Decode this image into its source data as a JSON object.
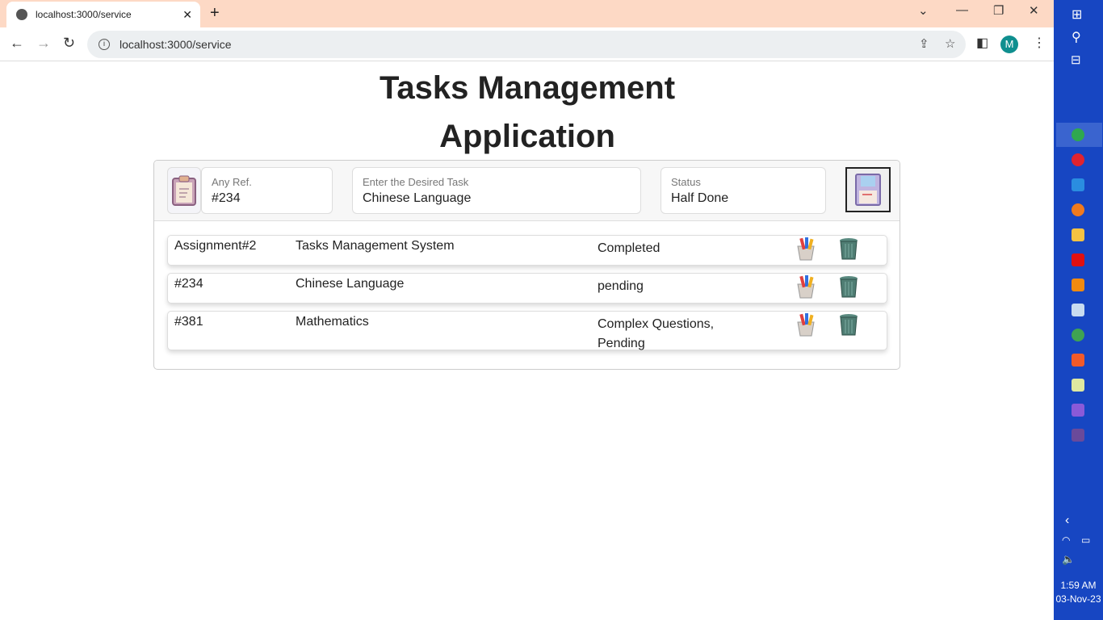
{
  "browser": {
    "tab_title": "localhost:3000/service",
    "url": "localhost:3000/service",
    "profile_initial": "M"
  },
  "page": {
    "title": "Tasks Management Application"
  },
  "form": {
    "ref": {
      "label": "Any Ref.",
      "value": "#234"
    },
    "task": {
      "label": "Enter the Desired Task",
      "value": "Chinese Language"
    },
    "status": {
      "label": "Status",
      "value": "Half Done"
    }
  },
  "tasks": [
    {
      "ref": "Assignment#2",
      "task": "Tasks Management System",
      "status": "Completed"
    },
    {
      "ref": "#234",
      "task": "Chinese Language",
      "status": "pending"
    },
    {
      "ref": "#381",
      "task": "Mathematics",
      "status": "Complex Questions, Pending"
    }
  ],
  "taskbar": {
    "time": "1:59 AM",
    "date": "03-Nov-23"
  }
}
